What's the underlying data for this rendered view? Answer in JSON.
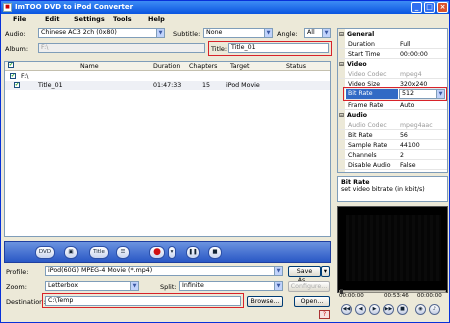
{
  "window": {
    "title": "ImTOO DVD to iPod Converter",
    "app_icon": "dvd-icon"
  },
  "menu": [
    "File",
    "Edit",
    "Settings",
    "Tools",
    "Help"
  ],
  "audio": {
    "label": "Audio:",
    "value": "Chinese AC3 2ch (0x80)"
  },
  "subtitle": {
    "label": "Subtitle:",
    "value": "None"
  },
  "angle": {
    "label": "Angle:",
    "value": "All"
  },
  "album": {
    "label": "Album:",
    "value": "F:\\"
  },
  "title_field": {
    "label": "Title:",
    "value": "Title_01"
  },
  "list": {
    "columns": [
      "Name",
      "Duration",
      "Chapters",
      "Target",
      "Status"
    ],
    "group": "F:\\",
    "rows": [
      {
        "name": "Title_01",
        "duration": "01:47:33",
        "chapters": "15",
        "target": "iPod Movie",
        "status": ""
      }
    ]
  },
  "profile": {
    "label": "Profile:",
    "value": "iPod(60G) MPEG-4 Movie  (*.mp4)",
    "save_as": "Save As..."
  },
  "zoom": {
    "label": "Zoom:",
    "value": "Letterbox"
  },
  "split": {
    "label": "Split:",
    "value": "Infinite",
    "configure": "Configure..."
  },
  "destination": {
    "label": "Destination:",
    "value": "C:\\Temp",
    "browse": "Browse...",
    "open": "Open..."
  },
  "controls": {
    "dvd": "DVD",
    "title": "Title"
  },
  "properties": {
    "sections": [
      {
        "name": "General",
        "rows": [
          {
            "key": "Duration",
            "value": "Full",
            "dim": false
          },
          {
            "key": "Start Time",
            "value": "00:00:00",
            "dim": false
          }
        ]
      },
      {
        "name": "Video",
        "rows": [
          {
            "key": "Video Codec",
            "value": "mpeg4",
            "dim": true
          },
          {
            "key": "Video Size",
            "value": "320x240",
            "dim": false
          },
          {
            "key": "Bit Rate",
            "value": "512",
            "dim": false,
            "selected": true
          },
          {
            "key": "Frame Rate",
            "value": "Auto",
            "dim": false
          }
        ]
      },
      {
        "name": "Audio",
        "rows": [
          {
            "key": "Audio Codec",
            "value": "mpeg4aac",
            "dim": true
          },
          {
            "key": "Bit Rate",
            "value": "56",
            "dim": false
          },
          {
            "key": "Sample Rate",
            "value": "44100",
            "dim": false
          },
          {
            "key": "Channels",
            "value": "2",
            "dim": false
          },
          {
            "key": "Disable Audio",
            "value": "False",
            "dim": false
          }
        ]
      }
    ]
  },
  "description": {
    "title": "Bit Rate",
    "text": "set video bitrate (in kbit/s)"
  },
  "player": {
    "current": "00:00:00",
    "total": "00:53:46",
    "position": "00:00:00"
  }
}
